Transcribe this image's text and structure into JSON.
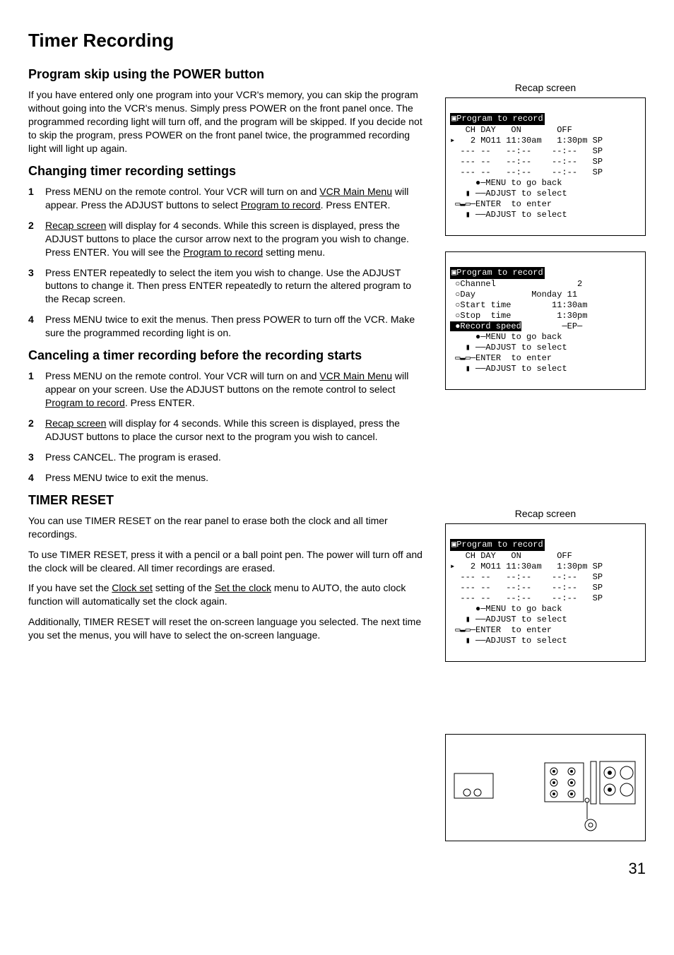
{
  "title": "Timer Recording",
  "sec1": {
    "heading": "Program skip using the POWER button",
    "body": "If you have entered only one program into your VCR's memory, you can skip the program without going into the VCR's menus. Simply press POWER on the front panel once.  The programmed recording light will turn off, and the program will be skipped.  If you decide not to skip the program, press POWER on the front panel twice, the programmed recording light will light up again."
  },
  "sec2": {
    "heading": "Changing timer recording settings",
    "steps": [
      {
        "n": "1",
        "a": "Press MENU on the remote control.  Your VCR will turn on and ",
        "u1": "VCR Main Menu",
        "b": " will appear.  Press the ADJUST buttons to select ",
        "u2": "Program to record",
        "c": ".  Press ENTER."
      },
      {
        "n": "2",
        "a": "",
        "u1": "Recap screen",
        "b": " will display for 4 seconds.  While this screen is displayed, press the ADJUST buttons to place the cursor arrow next to the program you wish to change.  Press ENTER.  You will see the ",
        "u2": "Program to record",
        "c": " setting menu."
      },
      {
        "n": "3",
        "plain": "Press ENTER repeatedly to select the item you wish to change.  Use the ADJUST buttons to change it.  Then press ENTER repeatedly to return the altered program to the Recap screen."
      },
      {
        "n": "4",
        "plain": "Press MENU twice to exit the menus.  Then press POWER to turn off the VCR.  Make sure the programmed recording light is on."
      }
    ]
  },
  "sec3": {
    "heading": "Canceling a timer recording before the recording starts",
    "steps": [
      {
        "n": "1",
        "a": "Press MENU on the remote control.  Your VCR will turn on and ",
        "u1": "VCR Main Menu",
        "b": " will appear on your screen.  Use the ADJUST buttons on the remote control to select ",
        "u2": "Program to record",
        "c": ".  Press ENTER."
      },
      {
        "n": "2",
        "a": "",
        "u1": "Recap screen",
        "b": " will display for 4 seconds.  While this screen is displayed, press the ADJUST buttons to place the cursor next to the program you wish to cancel.",
        "u2": "",
        "c": ""
      },
      {
        "n": "3",
        "plain": "Press CANCEL.  The program is erased."
      },
      {
        "n": "4",
        "plain": "Press MENU twice to exit the menus."
      }
    ]
  },
  "sec4": {
    "heading": "TIMER RESET",
    "p1": "You can use TIMER RESET on the rear panel to erase both the clock and all timer recordings.",
    "p2": "To use TIMER RESET, press it with a pencil or a ball point pen.  The power will turn off and the clock will be cleared.  All timer recordings are erased.",
    "p3a": "If you have set the ",
    "p3u1": "Clock set",
    "p3b": " setting of the ",
    "p3u2": "Set the clock",
    "p3c": " menu to AUTO, the auto clock function will automatically set the clock again.",
    "p4": "Additionally, TIMER RESET will reset the on-screen language you selected.  The next time you set the menus, you will have to select the on-screen language."
  },
  "right": {
    "recap1_label": "Recap screen",
    "recap2_label": "Recap screen",
    "recap_title": "Program to record",
    "recap_header": "   CH DAY   ON       OFF",
    "recap_row1": "▸   2 MO11 11:30am   1:30pm SP",
    "recap_row2": "  --- --   --:--    --:--   SP",
    "recap_row3": "  --- --   --:--    --:--   SP",
    "recap_row4": "  --- --   --:--    --:--   SP",
    "hint1": "     ●─MENU to go back",
    "hint2": "   ▮ ──ADJUST to select",
    "hint3": " ▭▬▭─ENTER  to enter",
    "hint4": "   ▮ ──ADJUST to select",
    "detail_title": "Program to record",
    "detail_channel_l": " ○Channel",
    "detail_channel_v": "2",
    "detail_day_l": " ○Day",
    "detail_day_v": "Monday 11",
    "detail_start_l": " ○Start time",
    "detail_start_v": "11:30am",
    "detail_stop_l": " ○Stop  time",
    "detail_stop_v": "1:30pm",
    "detail_speed_l": " ●Record speed",
    "detail_speed_v": "─EP─"
  },
  "page": "31"
}
